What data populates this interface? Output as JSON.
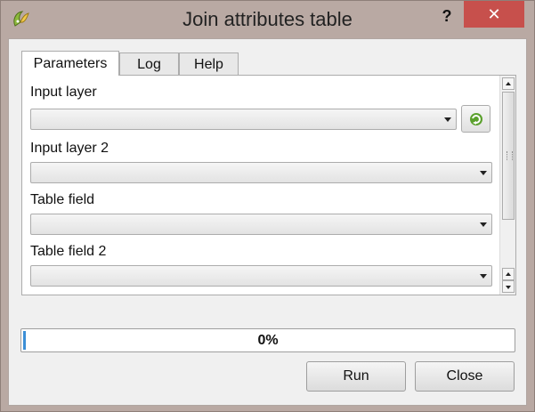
{
  "window": {
    "title": "Join attributes table",
    "help_glyph": "?",
    "close_glyph": "✕"
  },
  "tabs": [
    {
      "label": "Parameters",
      "active": true
    },
    {
      "label": "Log",
      "active": false
    },
    {
      "label": "Help",
      "active": false
    }
  ],
  "fields": [
    {
      "label": "Input layer",
      "value": ""
    },
    {
      "label": "Input layer 2",
      "value": ""
    },
    {
      "label": "Table field",
      "value": ""
    },
    {
      "label": "Table field 2",
      "value": ""
    }
  ],
  "progress": {
    "value": 0,
    "text": "0%"
  },
  "buttons": {
    "run": "Run",
    "close": "Close"
  },
  "colors": {
    "frame": "#b9a9a3",
    "close_red": "#c7504c",
    "progress_blue": "#3c8fd6"
  }
}
